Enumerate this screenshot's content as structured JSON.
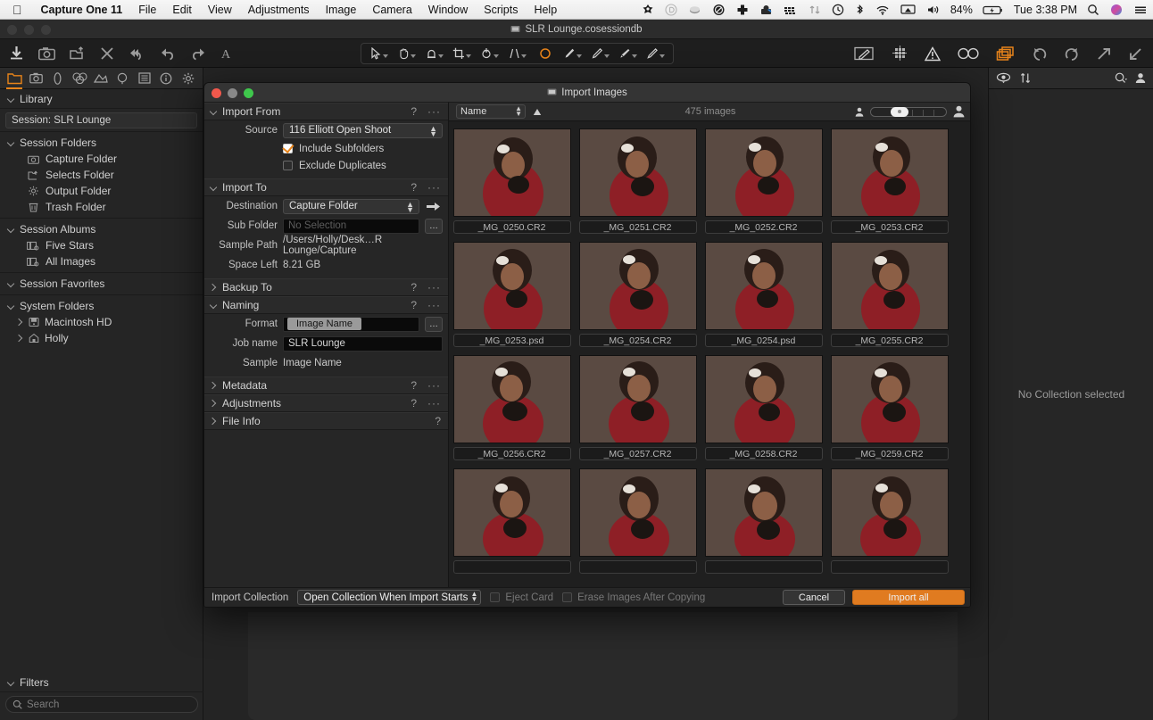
{
  "menubar": {
    "apple": "apple-logo",
    "app": "Capture One 11",
    "items": [
      "File",
      "Edit",
      "View",
      "Adjustments",
      "Image",
      "Camera",
      "Window",
      "Scripts",
      "Help"
    ],
    "status_icons": [
      "alfred-icon",
      "dropbox-icon",
      "cloud-icon",
      "creative-cloud-icon",
      "plus-icon",
      "backup-icon",
      "keyboard-icon",
      "transfer-icon",
      "time-machine-icon",
      "bluetooth-icon",
      "wifi-icon",
      "airplay-icon",
      "volume-icon"
    ],
    "battery": "84%",
    "battery_icon": "battery-charging-icon",
    "clock": "Tue 3:38 PM",
    "search_icon": "spotlight-search-icon",
    "siri_icon": "siri-icon",
    "controlcenter_icon": "notification-center-icon"
  },
  "window": {
    "title": "SLR Lounge.cosessiondb",
    "title_icon": "session-icon"
  },
  "toolbar": {
    "left_icons": [
      "import-icon",
      "capture-icon",
      "export-icon",
      "close-icon",
      "undo-all-icon",
      "undo-icon",
      "redo-icon",
      "text-tool-icon"
    ],
    "tools": [
      "pointer-tool",
      "pan-tool",
      "white-balance-tool",
      "crop-tool",
      "rotate-tool",
      "keystone-tool",
      "spot-removal-tool",
      "draw-mask-tool",
      "erase-mask-tool",
      "linear-gradient-tool",
      "heal-tool"
    ],
    "right_icons": [
      "edit-with-icon",
      "grid-overlay-icon",
      "warning-icon",
      "view-compare-icon",
      "variants-icon",
      "rotate-left-icon",
      "rotate-right-icon",
      "expand-icon",
      "collapse-icon"
    ]
  },
  "sidebar": {
    "tabs": [
      "library-tab",
      "capture-tab",
      "lens-tab",
      "color-tab",
      "exposure-tab",
      "details-tab",
      "adjustments-tab",
      "metadata-tab",
      "output-tab"
    ],
    "active_tab": "library-tab",
    "library_label": "Library",
    "session_field": "Session: SLR Lounge",
    "groups": [
      {
        "label": "Session Folders",
        "items": [
          {
            "label": "Capture Folder",
            "icon": "camera-icon"
          },
          {
            "label": "Selects Folder",
            "icon": "selects-icon"
          },
          {
            "label": "Output Folder",
            "icon": "gear-icon"
          },
          {
            "label": "Trash Folder",
            "icon": "trash-icon"
          }
        ]
      },
      {
        "label": "Session Albums",
        "items": [
          {
            "label": "Five Stars",
            "icon": "album-icon"
          },
          {
            "label": "All Images",
            "icon": "album-icon"
          }
        ]
      },
      {
        "label": "Session Favorites",
        "items": []
      },
      {
        "label": "System Folders",
        "items": [
          {
            "label": "Macintosh HD",
            "icon": "disk-icon"
          },
          {
            "label": "Holly",
            "icon": "home-icon"
          }
        ]
      }
    ],
    "filters_label": "Filters",
    "search_placeholder": "Search",
    "search_icon": "magnifier-icon"
  },
  "right_panel": {
    "tabs": [
      "view-icon",
      "sort-icon",
      "search-icon",
      "user-icon"
    ],
    "empty_text": "No Collection selected"
  },
  "dialog": {
    "title": "Import Images",
    "title_icon": "import-window-icon",
    "traffic_lights": [
      "close",
      "minimize",
      "zoom"
    ],
    "panels": [
      {
        "id": "import-from",
        "label": "Import From",
        "expanded": true,
        "help": "?",
        "menu": "···"
      },
      {
        "id": "import-to",
        "label": "Import To",
        "expanded": true,
        "help": "?",
        "menu": "···"
      },
      {
        "id": "backup-to",
        "label": "Backup To",
        "expanded": false,
        "help": "?",
        "menu": "···"
      },
      {
        "id": "naming",
        "label": "Naming",
        "expanded": true,
        "help": "?",
        "menu": "···"
      },
      {
        "id": "metadata",
        "label": "Metadata",
        "expanded": false,
        "help": "?",
        "menu": "···"
      },
      {
        "id": "adjustments",
        "label": "Adjustments",
        "expanded": false,
        "help": "?",
        "menu": "···"
      },
      {
        "id": "file-info",
        "label": "File Info",
        "expanded": false,
        "help": "?",
        "menu": ""
      }
    ],
    "import_from": {
      "source_label": "Source",
      "source_value": "116 Elliott Open Shoot",
      "include_subfolders_label": "Include Subfolders",
      "include_subfolders_checked": true,
      "exclude_duplicates_label": "Exclude Duplicates",
      "exclude_duplicates_checked": false
    },
    "import_to": {
      "destination_label": "Destination",
      "destination_value": "Capture Folder",
      "goto_icon": "arrow-right-icon",
      "subfolder_label": "Sub Folder",
      "subfolder_placeholder": "No Selection",
      "subfolder_more": "…",
      "sample_path_label": "Sample Path",
      "sample_path_value": "/Users/Holly/Desk…R Lounge/Capture",
      "space_left_label": "Space Left",
      "space_left_value": "8.21 GB"
    },
    "naming": {
      "format_label": "Format",
      "format_token": "Image Name",
      "format_more": "…",
      "job_name_label": "Job name",
      "job_name_value": "SLR Lounge",
      "sample_label": "Sample",
      "sample_value": "Image Name"
    },
    "browser": {
      "sort_value": "Name",
      "sort_direction_icon": "sort-ascending-icon",
      "image_count": "475 images",
      "small_thumb_icon": "small-thumbnail-icon",
      "large_thumb_icon": "large-thumbnail-icon",
      "thumbnails": [
        {
          "name": "_MG_0250.CR2",
          "selected": false
        },
        {
          "name": "_MG_0251.CR2",
          "selected": false
        },
        {
          "name": "_MG_0252.CR2",
          "selected": false
        },
        {
          "name": "_MG_0253.CR2",
          "selected": false
        },
        {
          "name": "_MG_0253.psd",
          "selected": false
        },
        {
          "name": "_MG_0254.CR2",
          "selected": false
        },
        {
          "name": "_MG_0254.psd",
          "selected": false
        },
        {
          "name": "_MG_0255.CR2",
          "selected": false
        },
        {
          "name": "_MG_0256.CR2",
          "selected": false
        },
        {
          "name": "_MG_0257.CR2",
          "selected": false
        },
        {
          "name": "_MG_0258.CR2",
          "selected": false
        },
        {
          "name": "_MG_0259.CR2",
          "selected": false
        },
        {
          "name": "",
          "selected": false
        },
        {
          "name": "",
          "selected": false
        },
        {
          "name": "",
          "selected": false
        },
        {
          "name": "",
          "selected": false
        }
      ]
    },
    "footer": {
      "import_collection_label": "Import Collection",
      "import_collection_value": "Open Collection When Import Starts",
      "eject_card_label": "Eject Card",
      "eject_card_checked": false,
      "erase_images_label": "Erase Images After Copying",
      "erase_images_checked": false,
      "cancel_label": "Cancel",
      "import_label": "Import all"
    }
  },
  "colors": {
    "accent": "#e8841a",
    "primary_button": "#e07b20",
    "panel_bg": "#262626",
    "browser_bg": "#1f1f1f"
  }
}
